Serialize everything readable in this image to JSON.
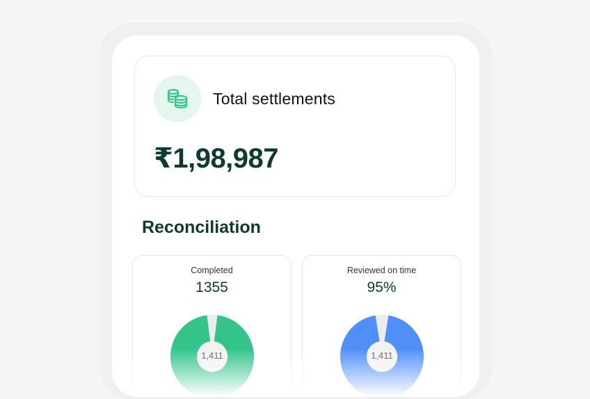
{
  "settlements": {
    "icon": "coins-icon",
    "title": "Total settlements",
    "amount": "₹1,98,987"
  },
  "reconciliation": {
    "title": "Reconciliation",
    "cards": [
      {
        "label": "Completed",
        "value": "1355",
        "center_label": "1,411",
        "color": "#34c48a",
        "fraction": 0.96
      },
      {
        "label": "Reviewed on time",
        "value": "95%",
        "center_label": "1,411",
        "color": "#4f8ff7",
        "fraction": 0.95
      }
    ]
  },
  "colors": {
    "accent_green": "#34c48a",
    "accent_blue": "#4f8ff7",
    "heading": "#0e3a33",
    "badge_bg": "#e4f6ee"
  }
}
